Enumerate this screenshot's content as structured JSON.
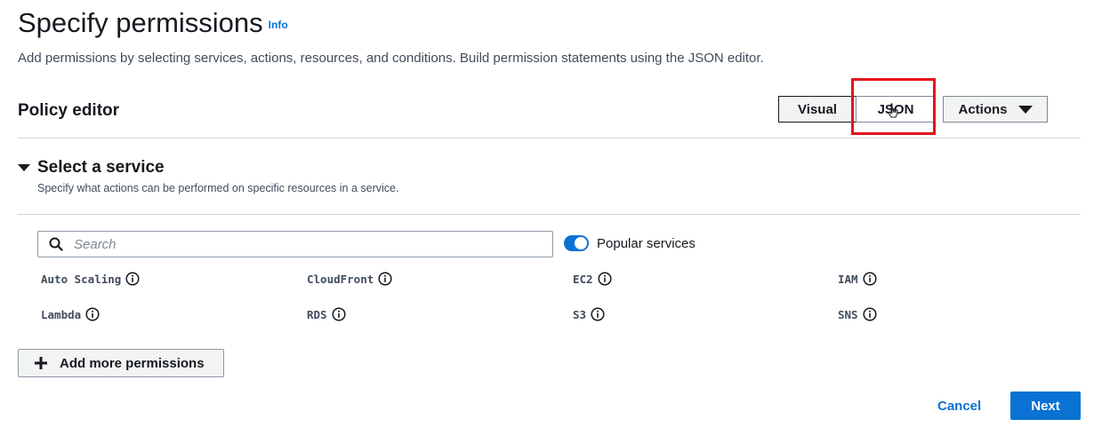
{
  "header": {
    "title": "Specify permissions",
    "info_link": "Info",
    "description": "Add permissions by selecting services, actions, resources, and conditions. Build permission statements using the JSON editor."
  },
  "policy_editor": {
    "title": "Policy editor",
    "mode_visual": "Visual",
    "mode_json": "JSON",
    "actions_label": "Actions"
  },
  "select_service": {
    "title": "Select a service",
    "description": "Specify what actions can be performed on specific resources in a service.",
    "search_placeholder": "Search",
    "popular_toggle_label": "Popular services",
    "popular_toggle_on": true,
    "services": [
      "Auto Scaling",
      "CloudFront",
      "EC2",
      "IAM",
      "Lambda",
      "RDS",
      "S3",
      "SNS"
    ]
  },
  "footer": {
    "add_permissions_label": "Add more permissions",
    "cancel_label": "Cancel",
    "next_label": "Next"
  },
  "colors": {
    "accent": "#0972d3",
    "highlight": "#e3131c"
  }
}
